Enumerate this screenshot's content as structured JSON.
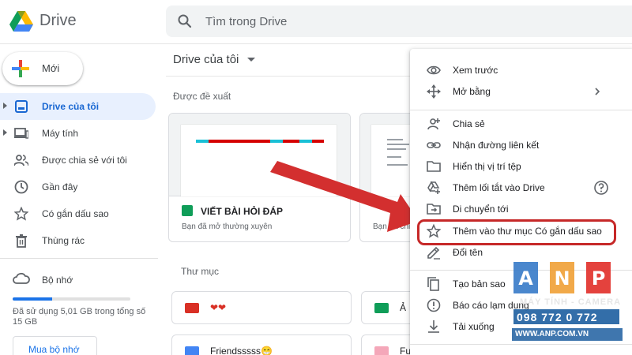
{
  "header": {
    "brand": "Drive",
    "search_placeholder": "Tìm trong Drive"
  },
  "sidebar": {
    "new_label": "Mới",
    "items": [
      {
        "label": "Drive của tôi",
        "icon": "my-drive-icon",
        "active": true
      },
      {
        "label": "Máy tính",
        "icon": "computer-icon"
      },
      {
        "label": "Được chia sẻ với tôi",
        "icon": "shared-people-icon"
      },
      {
        "label": "Gần đây",
        "icon": "clock-icon"
      },
      {
        "label": "Có gắn dấu sao",
        "icon": "star-icon"
      },
      {
        "label": "Thùng rác",
        "icon": "trash-icon"
      }
    ],
    "storage": {
      "label": "Bộ nhớ",
      "used_text": "Đã sử dụng 5,01 GB trong tổng số 15 GB",
      "used_fraction": 0.334,
      "buy_label": "Mua bộ nhớ"
    }
  },
  "main": {
    "title": "Drive của tôi",
    "suggested_title": "Được đề xuất",
    "cards": [
      {
        "title": "VIẾT BÀI HỎI ĐÁP",
        "subtitle": "Bạn đã mở thường xuyên"
      },
      {
        "title": "",
        "subtitle": "Bạn đã chỉ"
      }
    ],
    "folders_title": "Thư mục",
    "folders": [
      {
        "label": "❤❤",
        "color": "#d93025"
      },
      {
        "label": "Ả",
        "color": "#0f9d58"
      },
      {
        "label": "Friendsssss😁",
        "color": "#4285f4"
      },
      {
        "label": "Fu",
        "color": "#f4a7b9"
      }
    ]
  },
  "context_menu": {
    "items": [
      {
        "label": "Xem trước",
        "icon": "eye-icon"
      },
      {
        "label": "Mở bằng",
        "icon": "move-arrows-icon",
        "submenu": true
      },
      {
        "label": "Chia sẻ",
        "icon": "add-person-icon"
      },
      {
        "label": "Nhận đường liên kết",
        "icon": "link-icon"
      },
      {
        "label": "Hiển thị vị trí tệp",
        "icon": "folder-icon"
      },
      {
        "label": "Thêm lối tắt vào Drive",
        "icon": "add-shortcut-icon",
        "help": true
      },
      {
        "label": "Di chuyển tới",
        "icon": "move-to-folder-icon"
      },
      {
        "label": "Thêm vào thư mục Có gắn dấu sao",
        "icon": "star-outline-icon",
        "highlighted": true
      },
      {
        "label": "Đổi tên",
        "icon": "pencil-icon"
      },
      {
        "label": "Tạo bản sao",
        "icon": "copy-icon"
      },
      {
        "label": "Báo cáo lạm dụng",
        "icon": "alert-icon"
      },
      {
        "label": "Tải xuống",
        "icon": "download-icon"
      }
    ]
  },
  "watermark": {
    "letters": [
      "A",
      "N",
      "P"
    ],
    "tagline": "MÁY TÍNH - CAMERA",
    "phone": "098 772 0 772",
    "url": "WWW.ANP.COM.VN",
    "colors": {
      "A": "#3b7dc9",
      "N": "#f0a23a",
      "P": "#e2322d",
      "blue": "#1d5ea0"
    }
  },
  "colors": {
    "accent": "#1a73e8",
    "active_nav_bg": "#e8f0fe",
    "annotation_red": "#c62828"
  }
}
